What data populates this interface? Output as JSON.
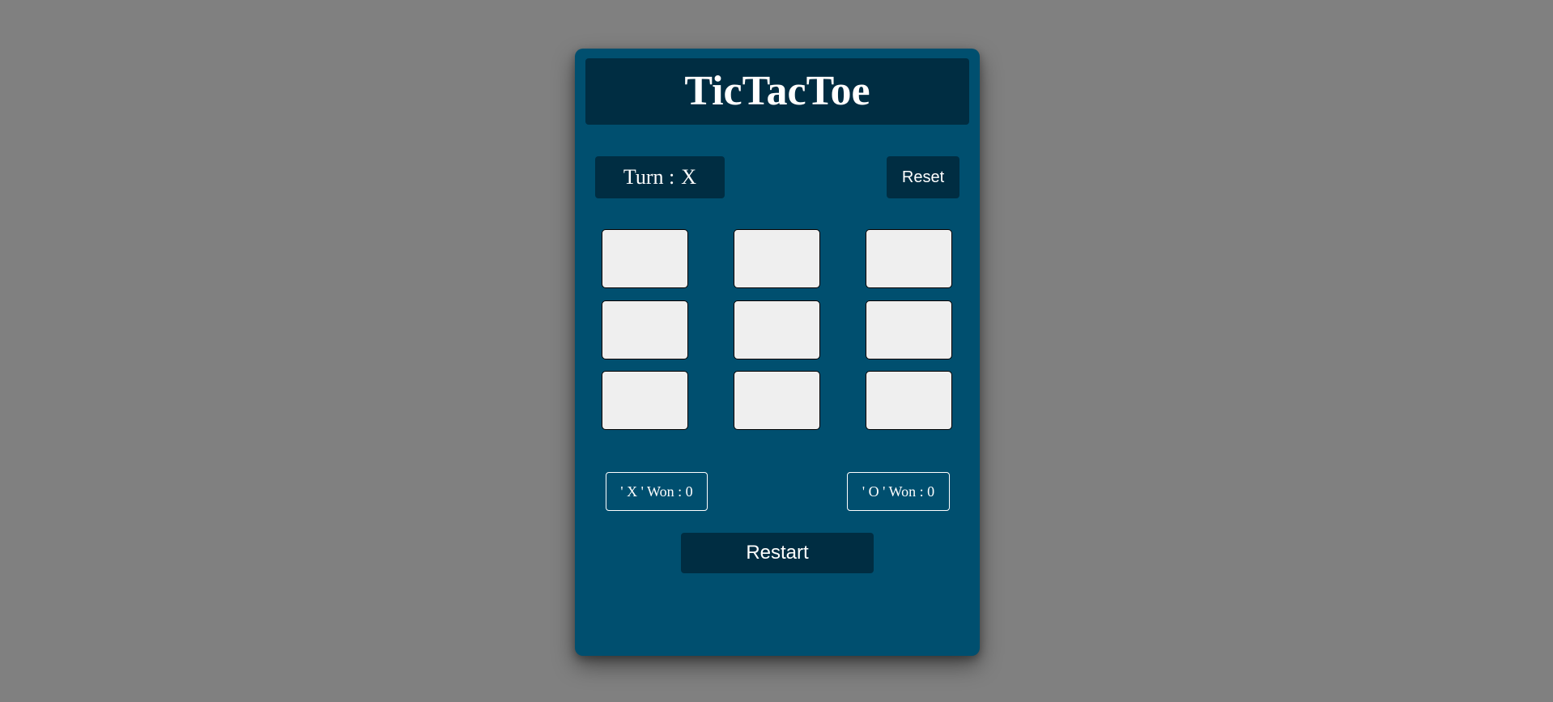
{
  "app": {
    "title": "TicTacToe"
  },
  "turn": {
    "label": "Turn :",
    "value": "X"
  },
  "controls": {
    "reset_label": "Reset",
    "restart_label": "Restart"
  },
  "board": {
    "cells": [
      "",
      "",
      "",
      "",
      "",
      "",
      "",
      "",
      ""
    ]
  },
  "scores": {
    "x_label": "' X ' Won :",
    "x_value": "0",
    "o_label": "' O ' Won :",
    "o_value": "0"
  },
  "colors": {
    "page_background": "#808080",
    "card_background": "#004f6f",
    "panel_dark": "#002d42",
    "cell_background": "#efefef",
    "text": "#ffffff"
  }
}
